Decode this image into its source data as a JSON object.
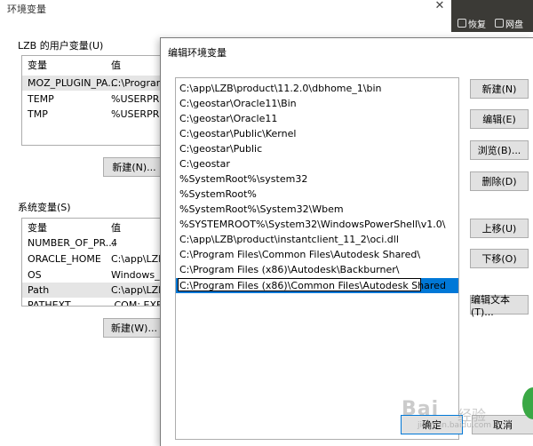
{
  "bg_window": {
    "title": "环境变量",
    "close_glyph": "✕",
    "taskbar": {
      "btn1": "恢复",
      "btn2": "网盘"
    },
    "user_vars": {
      "label": "LZB 的用户变量(U)",
      "headers": [
        "变量",
        "值"
      ],
      "rows": [
        [
          "MOZ_PLUGIN_PA...",
          "C:\\Program"
        ],
        [
          "TEMP",
          "%USERPRO"
        ],
        [
          "TMP",
          "%USERPRO"
        ]
      ],
      "new_button": "新建(N)..."
    },
    "sys_vars": {
      "label": "系统变量(S)",
      "headers": [
        "变量",
        "值"
      ],
      "rows": [
        [
          "NUMBER_OF_PR...",
          "4"
        ],
        [
          "ORACLE_HOME",
          "C:\\app\\LZB\\"
        ],
        [
          "OS",
          "Windows_N"
        ],
        [
          "Path",
          "C:\\app\\LZB\\"
        ],
        [
          "PATHEXT",
          ".COM;.EXE;"
        ]
      ],
      "new_button": "新建(W)..."
    }
  },
  "edit_dialog": {
    "title": "编辑环境变量",
    "paths": [
      "C:\\app\\LZB\\product\\11.2.0\\dbhome_1\\bin",
      "C:\\geostar\\Oracle11\\Bin",
      "C:\\geostar\\Oracle11",
      "C:\\geostar\\Public\\Kernel",
      "C:\\geostar\\Public",
      "C:\\geostar",
      "%SystemRoot%\\system32",
      "%SystemRoot%",
      "%SystemRoot%\\System32\\Wbem",
      "%SYSTEMROOT%\\System32\\WindowsPowerShell\\v1.0\\",
      "C:\\app\\LZB\\product\\instantclient_11_2\\oci.dll",
      "C:\\Program Files\\Common Files\\Autodesk Shared\\",
      "C:\\Program Files (x86)\\Autodesk\\Backburner\\",
      "C:\\Program Files (x86)\\Common Files\\Autodesk Shared"
    ],
    "buttons": {
      "new": "新建(N)",
      "edit": "编辑(E)",
      "browse": "浏览(B)...",
      "delete": "删除(D)",
      "up": "上移(U)",
      "down": "下移(O)",
      "edit_text": "编辑文本(T)..."
    },
    "ok": "确定",
    "cancel": "取消"
  },
  "watermark": {
    "brand": "Bai",
    "sub": "经验",
    "url": "jingyan.baidu.com"
  },
  "colors": {
    "selection": "#0078d7",
    "button_bg": "#e1e1e1",
    "border": "#adadad"
  }
}
